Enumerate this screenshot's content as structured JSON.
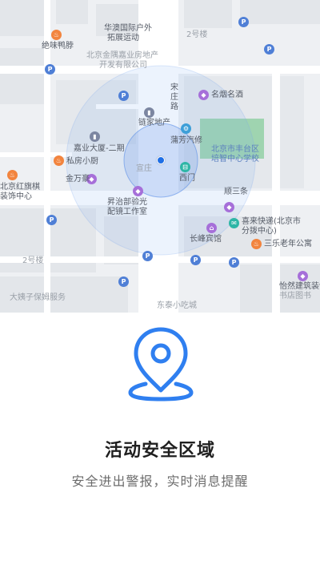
{
  "map": {
    "labels": {
      "jiuyuan": "华澳国际户外",
      "tuozhan": "拓展运动",
      "juewei": "绝味鸭脖",
      "jinyu_line1": "北京金隅嘉业房地产",
      "jinyu_line2": "开发有限公司",
      "building2": "2号楼",
      "songzhuang_line1": "宋",
      "songzhuang_line2": "庄",
      "songzhuang_line3": "路",
      "mingyan": "名烟名酒",
      "lianjia": "链家地产",
      "pufang": "蒲芳汽修",
      "jiaye": "嘉业大厦-二期",
      "fengtai_line1": "北京市丰台区",
      "fengtai_line2": "培智中心学校",
      "sifang": "私房小厨",
      "xuanzheng": "宣庄",
      "ximen": "西门",
      "jinwanhao": "金万豪",
      "hongqi_line1": "北京红旗棋",
      "hongqi_line2": "装饰中心",
      "shuntiao": "顺三条",
      "shengzhi_line1": "昇治部验光",
      "shengzhi_line2": "配镜工作室",
      "xilai_line1": "喜来快递(北京市",
      "xilai_line2": "分拨中心)",
      "changfeng": "长峰宾馆",
      "sanle": "三乐老年公寓",
      "building2b": "2号楼",
      "yiran_line1": "怡然建筑装饰",
      "yiran_line2": "书店图书",
      "dayin": "大姨子保姆服务",
      "dongtai": "东泰小吃城"
    },
    "location_marker": "current-location"
  },
  "feature": {
    "icon": "location-pin-icon",
    "title": "活动安全区域",
    "subtitle": "安全进出警报，实时消息提醒"
  },
  "colors": {
    "accent": "#2f7ff0",
    "map_bg": "#eef0f3",
    "safe_zone": "#7aa8f0"
  }
}
